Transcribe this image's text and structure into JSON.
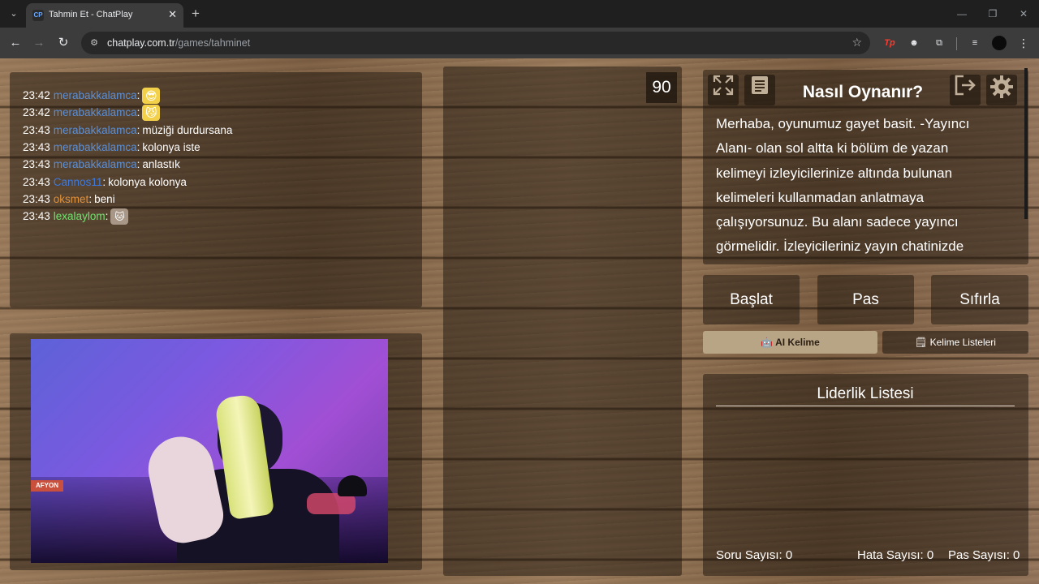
{
  "browser": {
    "tab": {
      "favicon_text": "CP",
      "title": "Tahmin Et - ChatPlay"
    },
    "url": {
      "host": "chatplay.com.tr",
      "path": "/games/tahminet"
    },
    "extensions": {
      "tp_label": "Tp"
    }
  },
  "chat": {
    "messages": [
      {
        "time": "23:42",
        "user": "merabakkalamca",
        "user_color": "#5b8fd6",
        "text": "",
        "emote": "emote-sunglasses"
      },
      {
        "time": "23:42",
        "user": "merabakkalamca",
        "user_color": "#5b8fd6",
        "text": "",
        "emote": "emote-cat-face"
      },
      {
        "time": "23:43",
        "user": "merabakkalamca",
        "user_color": "#5b8fd6",
        "text": "müziği durdursana"
      },
      {
        "time": "23:43",
        "user": "merabakkalamca",
        "user_color": "#5b8fd6",
        "text": "kolonya iste"
      },
      {
        "time": "23:43",
        "user": "merabakkalamca",
        "user_color": "#5b8fd6",
        "text": "anlastık"
      },
      {
        "time": "23:43",
        "user": "Cannos11",
        "user_color": "#3d7be0",
        "text": "kolonya kolonya"
      },
      {
        "time": "23:43",
        "user": "oksmet",
        "user_color": "#e0913a",
        "text": "beni"
      },
      {
        "time": "23:43",
        "user": "lexalaylom",
        "user_color": "#6fe36f",
        "text": "",
        "emote": "emote-cat-photo"
      }
    ]
  },
  "webcam": {
    "banner_text": "AFYON"
  },
  "game": {
    "timer": "90",
    "howto": {
      "title": "Nasıl Oynanır?",
      "text": "Merhaba, oyunumuz gayet basit. -Yayıncı Alanı- olan sol altta ki bölüm de yazan kelimeyi izleyicilerinize altında bulunan kelimeleri kullanmadan anlatmaya çalışıyorsunuz. Bu alanı sadece yayıncı görmelidir. İzleyicileriniz yayın chatinizde"
    },
    "buttons": {
      "start": "Başlat",
      "pass": "Pas",
      "reset": "Sıfırla"
    },
    "tabs": {
      "ai_word": "AI Kelime",
      "word_lists": "Kelime Listeleri"
    },
    "leaderboard": {
      "title": "Liderlik Listesi",
      "question_count_label": "Soru Sayısı: 0",
      "error_count_label": "Hata Sayısı: 0",
      "pass_count_label": "Pas Sayısı: 0"
    }
  },
  "colors": {
    "accent_tab": "#b8a586",
    "panel": "rgba(28,20,12,0.5)"
  }
}
